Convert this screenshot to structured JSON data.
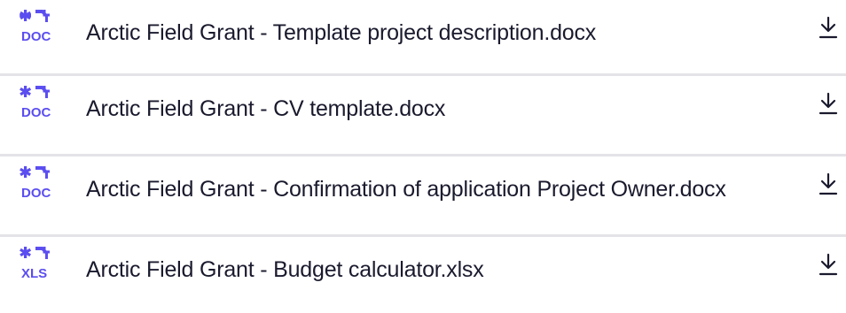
{
  "colors": {
    "icon_accent": "#5b4ef0",
    "text": "#1a1a2e",
    "divider": "#e3e3e8",
    "download_icon": "#1a1a2e"
  },
  "files": [
    {
      "name": "Arctic Field Grant - Template project description.docx",
      "type_label": "DOC",
      "icon": "doc-file-icon",
      "action_icon": "download-icon"
    },
    {
      "name": "Arctic Field Grant - CV template.docx",
      "type_label": "DOC",
      "icon": "doc-file-icon",
      "action_icon": "download-icon"
    },
    {
      "name": "Arctic Field Grant - Confirmation of application Project Owner.docx",
      "type_label": "DOC",
      "icon": "doc-file-icon",
      "action_icon": "download-icon"
    },
    {
      "name": "Arctic Field Grant - Budget calculator.xlsx",
      "type_label": "XLS",
      "icon": "xls-file-icon",
      "action_icon": "download-icon"
    }
  ]
}
